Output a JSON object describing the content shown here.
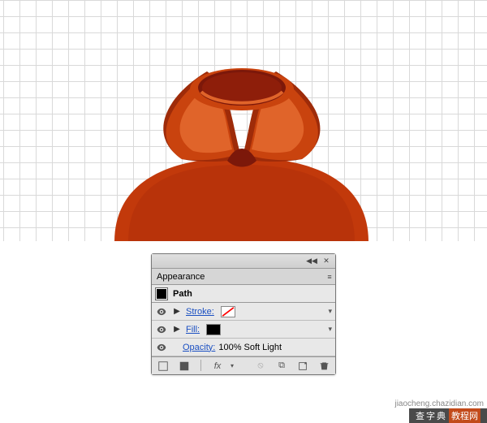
{
  "panel": {
    "title": "Appearance",
    "path_label": "Path",
    "stroke_label": "Stroke:",
    "fill_label": "Fill:",
    "opacity_label": "Opacity:",
    "opacity_value": "100% Soft Light"
  },
  "icons": {
    "menu": "≡",
    "collapse": "◀◀",
    "close": "✕",
    "tri_right": "▶",
    "chev_down": "▾",
    "fx": "fx",
    "dup": "⧉",
    "new": "⊞",
    "trash": "🗑",
    "block": "⦸",
    "clear": "◯"
  },
  "branding": {
    "site_cn": "查字典",
    "site_sub": "教程网",
    "url": "jiaocheng.chazidian.com"
  },
  "colors": {
    "dark_orange": "#9a2c0d",
    "mid_orange": "#c9430e",
    "light_orange": "#e0642a",
    "deep_red": "#7c180a"
  }
}
